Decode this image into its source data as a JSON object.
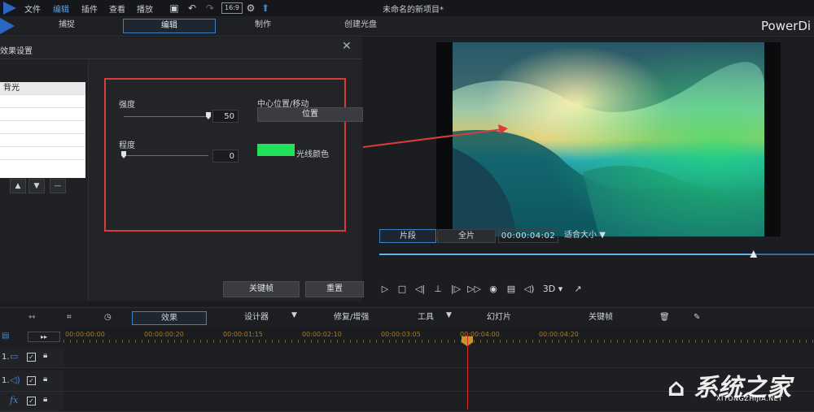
{
  "menubar": {
    "items": [
      "文件",
      "编辑",
      "插件",
      "查看",
      "播放"
    ],
    "active_index": 1,
    "aspect_badge": "16:9",
    "project_title": "未命名的新项目*"
  },
  "modes": {
    "tabs": [
      "捕捉",
      "编辑",
      "制作",
      "创建光盘"
    ],
    "active_index": 1,
    "brand": "PowerDi"
  },
  "effect_panel": {
    "title": "效果设置",
    "list": [
      "背光",
      "",
      "",
      "",
      "",
      "",
      ""
    ],
    "selected_index": 0,
    "intensity_label": "强度",
    "intensity_value": "50",
    "intensity_level": 1.0,
    "degree_label": "程度",
    "degree_value": "0",
    "degree_level": 0.0,
    "center_label": "中心位置/移动",
    "position_button": "位置",
    "color_label": "光线颜色",
    "color": "#22e05a",
    "keyframe_button": "关键帧",
    "reset_button": "重置"
  },
  "preview": {
    "clip_tab": "片段",
    "movie_tab": "全片",
    "timecode": "00:00:04:02",
    "fit_label": "适合大小",
    "threed_label": "3D",
    "progress": 0.86
  },
  "timeline_toolbar": {
    "effect_tab": "效果",
    "designer": "设计器",
    "fix_enhance": "修复/增强",
    "tools": "工具",
    "slideshow": "幻灯片",
    "keyframe": "关键帧"
  },
  "ruler": {
    "labels": [
      "00:00:00:00",
      "00:00:00:20",
      "00:00:01:15",
      "00:00:02:10",
      "00:00:03:05",
      "00:00:04:00",
      "00:00:04:20"
    ]
  },
  "tracks": [
    {
      "num": "1.",
      "icon": "video-track-icon"
    },
    {
      "num": "1.",
      "icon": "audio-track-icon"
    },
    {
      "num": "",
      "icon": "fx-track-icon"
    }
  ],
  "watermark": {
    "logo": "系统之家",
    "url": "XITONGZHIJIA.NET"
  },
  "colors": {
    "accent": "#3c82c8",
    "highlight_box": "#d93c3c",
    "playhead": "#d92b2b"
  }
}
